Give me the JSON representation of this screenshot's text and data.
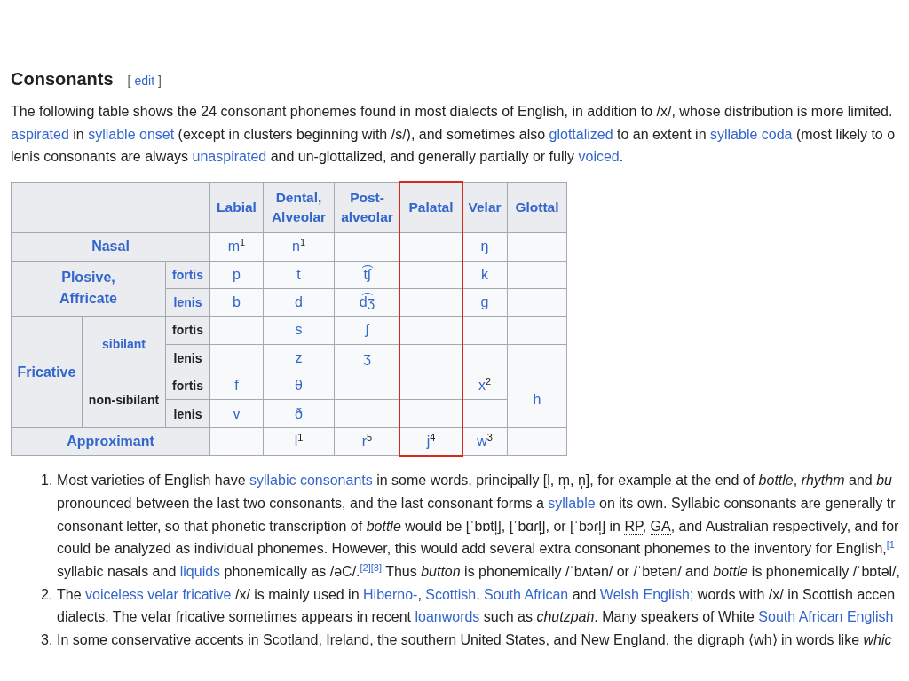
{
  "section": {
    "heading": "Consonants",
    "edit": {
      "open": "[",
      "link": "edit",
      "close": "]"
    }
  },
  "intro": {
    "lines": [
      [
        {
          "kind": "text",
          "text": "The following table shows the 24 consonant phonemes found in most dialects of English, in addition to /x/, whose distribution is more limited."
        }
      ],
      [
        {
          "kind": "link",
          "text": "aspirated"
        },
        {
          "kind": "link",
          "lead": " in ",
          "text": "syllable onset"
        },
        {
          "kind": "link",
          "lead": " (except in clusters beginning with /s/), and sometimes also ",
          "text": "glottalized"
        },
        {
          "kind": "link",
          "lead": " to an extent in ",
          "text": "syllable coda"
        },
        {
          "kind": "text",
          "text": " (most likely to o"
        }
      ],
      [
        {
          "kind": "link",
          "lead": "lenis consonants are always ",
          "text": "unaspirated"
        },
        {
          "kind": "link",
          "lead": " and un-glottalized, and generally partially or fully ",
          "text": "voiced"
        },
        {
          "kind": "text",
          "text": "."
        }
      ]
    ]
  },
  "table": {
    "columns": [
      {
        "label": "Labial",
        "highlighted": false
      },
      {
        "label": "Dental, Alveolar",
        "highlighted": false
      },
      {
        "label": "Post-alveolar",
        "highlighted": false
      },
      {
        "label": "Palatal",
        "highlighted": true
      },
      {
        "label": "Velar",
        "highlighted": false
      },
      {
        "label": "Glottal",
        "highlighted": false
      }
    ],
    "manners": [
      {
        "label": "Nasal",
        "link": true,
        "cells": [
          "m$^{1}$",
          "n$^{1}$",
          null,
          null,
          "ŋ",
          null
        ]
      },
      {
        "label": "Plosive,\nAffricate",
        "link": true,
        "children": [
          {
            "label": "fortis",
            "link": true,
            "cells": [
              "p",
              "t",
              "t͡ʃ",
              null,
              "k",
              null
            ]
          },
          {
            "label": "lenis",
            "link": true,
            "cells": [
              "b",
              "d",
              "d͡ʒ",
              null,
              "ɡ",
              null
            ]
          }
        ]
      },
      {
        "label": "Fricative",
        "link": true,
        "children": [
          {
            "label": "sibilant",
            "link": true,
            "children": [
              {
                "label": "fortis",
                "link": false,
                "cells": [
                  null,
                  "s",
                  "ʃ",
                  null,
                  null,
                  null
                ]
              },
              {
                "label": "lenis",
                "link": false,
                "cells": [
                  null,
                  "z",
                  "ʒ",
                  null,
                  null,
                  null
                ]
              }
            ]
          },
          {
            "label": "non-sibilant",
            "link": false,
            "cells": [
              null,
              null,
              null,
              null,
              null,
              "h"
            ],
            "children": [
              {
                "label": "fortis",
                "link": false,
                "cells": [
                  "f",
                  "θ",
                  null,
                  null,
                  "x$^{2}$",
                  null
                ]
              },
              {
                "label": "lenis",
                "link": false,
                "cells": [
                  "v",
                  "ð",
                  null,
                  null,
                  null,
                  null
                ]
              }
            ]
          }
        ]
      },
      {
        "label": "Approximant",
        "link": true,
        "cells": [
          null,
          "l$^{1}$",
          "r$^{5}$",
          "j$^{4}$",
          "w$^{3}$",
          null
        ]
      }
    ]
  },
  "footnotes": [
    {
      "number": "1.",
      "lines": [
        [
          {
            "kind": "link",
            "lead": "Most varieties of English have ",
            "text": "syllabic consonants"
          },
          {
            "kind": "text",
            "text": " in some words, principally [l̩, m̩, n̩], for example at the end of *bottle*, *rhythm* and *bu*"
          }
        ],
        [
          {
            "kind": "link",
            "lead": "pronounced between the last two consonants, and the last consonant forms a ",
            "text": "syllable"
          },
          {
            "kind": "text",
            "text": " on its own. Syllabic consonants are generally tr"
          }
        ],
        [
          {
            "kind": "abbr",
            "lead": "consonant letter, so that phonetic transcription of *bottle* would be [ˈbɒtl̩], [ˈbɑɾl̩], or [ˈbɔɾl̩] in ",
            "text": "RP"
          },
          {
            "kind": "abbr",
            "lead": ", ",
            "text": "GA"
          },
          {
            "kind": "text",
            "text": ", and Australian respectively, and for"
          }
        ],
        [
          {
            "kind": "cite",
            "lead": "could be analyzed as individual phonemes. However, this would add several extra consonant phonemes to the inventory for English,",
            "text": "[1"
          }
        ],
        [
          {
            "kind": "link",
            "lead": "syllabic nasals and ",
            "text": "liquids"
          },
          {
            "kind": "cite",
            "lead": " phonemically as /əC/.",
            "text": "[2]"
          },
          {
            "kind": "cite",
            "text": "[3]"
          },
          {
            "kind": "text",
            "text": " Thus *button* is phonemically /ˈbʌtən/ or /ˈbɐtən/ and *bottle* is phonemically /ˈbɒtəl/,"
          }
        ]
      ]
    },
    {
      "number": "2.",
      "lines": [
        [
          {
            "kind": "link",
            "lead": "The ",
            "text": "voiceless velar fricative"
          },
          {
            "kind": "link",
            "lead": " /x/ is mainly used in ",
            "text": "Hiberno-"
          },
          {
            "kind": "link",
            "lead": ", ",
            "text": "Scottish"
          },
          {
            "kind": "link",
            "lead": ", ",
            "text": "South African"
          },
          {
            "kind": "link",
            "lead": " and ",
            "text": "Welsh English"
          },
          {
            "kind": "text",
            "text": "; words with /x/ in Scottish accen"
          }
        ],
        [
          {
            "kind": "link",
            "lead": "dialects. The velar fricative sometimes appears in recent ",
            "text": "loanwords"
          },
          {
            "kind": "link",
            "lead": " such as *chutzpah*. Many speakers of White ",
            "text": "South African English"
          }
        ]
      ]
    },
    {
      "number": "3.",
      "lines": [
        [
          {
            "kind": "text",
            "text": "In some conservative accents in Scotland, Ireland, the southern United States, and New England, the digraph ⟨wh⟩ in words like *whic*"
          }
        ]
      ]
    }
  ]
}
